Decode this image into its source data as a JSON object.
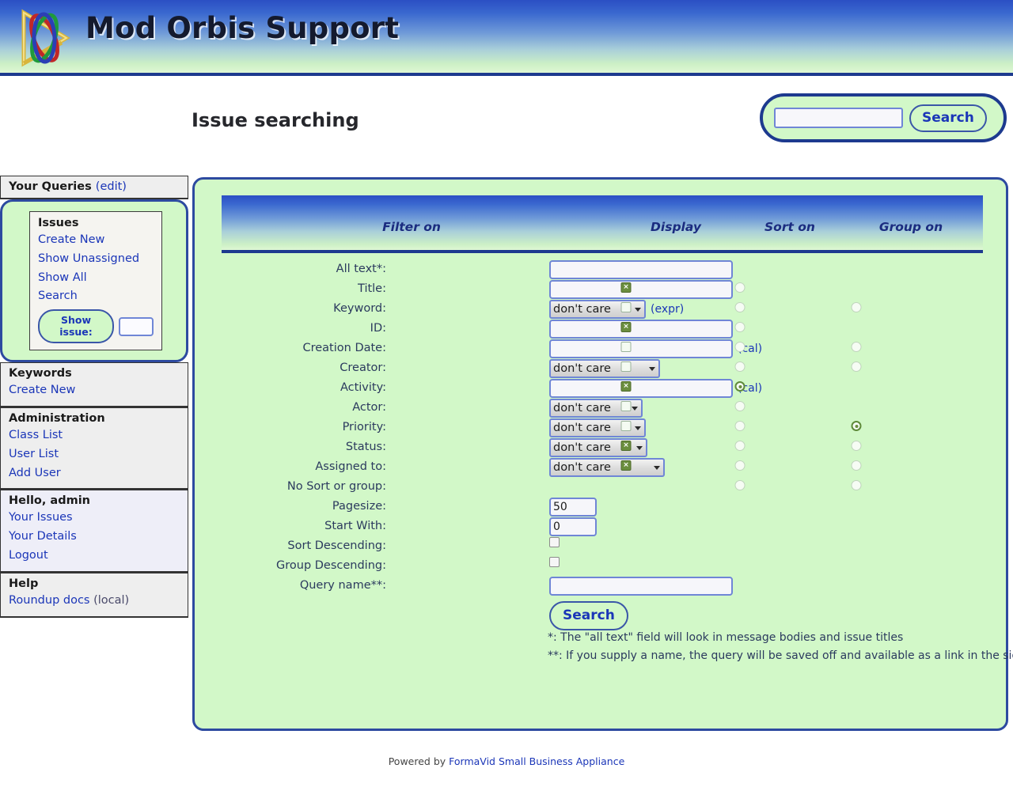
{
  "masthead": {
    "title": "Mod Orbis Support",
    "logo_icon": "orbis-rings-logo-icon"
  },
  "page": {
    "title": "Issue searching"
  },
  "global_search": {
    "value": "",
    "placeholder": "",
    "button_label": "Search",
    "icon": "search-icon"
  },
  "sidebar": {
    "queries": {
      "title": "Your Queries",
      "edit_label": "(edit)",
      "group_title": "Issues",
      "links": [
        "Create New",
        "Show Unassigned",
        "Show All",
        "Search"
      ],
      "show_issue_label": "Show issue:",
      "show_issue_value": ""
    },
    "sections": [
      {
        "title": "Keywords",
        "links": [
          "Create New"
        ],
        "variant": "plain"
      },
      {
        "title": "Administration",
        "links": [
          "Class List",
          "User List",
          "Add User"
        ],
        "variant": "plain"
      },
      {
        "title": "Hello, admin",
        "links": [
          "Your Issues",
          "Your Details",
          "Logout"
        ],
        "variant": "user"
      },
      {
        "title": "Help",
        "links": [
          "Roundup docs"
        ],
        "link_suffix": " (local)",
        "variant": "plain"
      }
    ]
  },
  "search_form": {
    "columns": [
      "Filter on",
      "Display",
      "Sort on",
      "Group on"
    ],
    "rows": [
      {
        "label": "All text*:",
        "control": "text",
        "value": "",
        "width": "wide",
        "hint": "",
        "display": null,
        "sort": null,
        "group": null
      },
      {
        "label": "Title:",
        "control": "text",
        "value": "",
        "width": "wide",
        "hint": "",
        "display": true,
        "sort": false,
        "group": null
      },
      {
        "label": "Keyword:",
        "control": "select",
        "value": "don't care",
        "select_width": 122,
        "hint": "(expr)",
        "display": false,
        "sort": false,
        "group": false
      },
      {
        "label": "ID:",
        "control": "text",
        "value": "",
        "width": "wide",
        "hint": "",
        "display": true,
        "sort": false,
        "group": null
      },
      {
        "label": "Creation Date:",
        "control": "text",
        "value": "",
        "width": "wide",
        "hint": "(cal)",
        "display": false,
        "sort": false,
        "group": false
      },
      {
        "label": "Creator:",
        "control": "select",
        "value": "don't care",
        "select_width": 140,
        "hint": "",
        "display": false,
        "sort": false,
        "group": false
      },
      {
        "label": "Activity:",
        "control": "text",
        "value": "",
        "width": "wide",
        "hint": "(cal)",
        "display": true,
        "sort": true,
        "group": null
      },
      {
        "label": "Actor:",
        "control": "select",
        "value": "don't care",
        "select_width": 118,
        "hint": "",
        "display": false,
        "sort": false,
        "group": null
      },
      {
        "label": "Priority:",
        "control": "select",
        "value": "don't care",
        "select_width": 122,
        "hint": "",
        "display": false,
        "sort": false,
        "group": true
      },
      {
        "label": "Status:",
        "control": "select",
        "value": "don't care",
        "select_width": 124,
        "hint": "",
        "display": true,
        "sort": false,
        "group": false
      },
      {
        "label": "Assigned to:",
        "control": "select",
        "value": "don't care",
        "select_width": 146,
        "hint": "",
        "display": true,
        "sort": false,
        "group": false
      },
      {
        "label": "No Sort or group:",
        "control": "none",
        "value": "",
        "hint": "",
        "display": null,
        "sort": false,
        "group": false
      },
      {
        "label": "Pagesize:",
        "control": "text",
        "value": "50",
        "width": "num",
        "hint": "",
        "display": null,
        "sort": null,
        "group": null
      },
      {
        "label": "Start With:",
        "control": "text",
        "value": "0",
        "width": "num",
        "hint": "",
        "display": null,
        "sort": null,
        "group": null
      },
      {
        "label": "Sort Descending:",
        "control": "checkbox",
        "checked": false,
        "hint": "",
        "display": null,
        "sort": null,
        "group": null
      },
      {
        "label": "Group Descending:",
        "control": "checkbox",
        "checked": false,
        "hint": "",
        "display": null,
        "sort": null,
        "group": null
      },
      {
        "label": "Query name**:",
        "control": "text",
        "value": "",
        "width": "wide",
        "hint": "",
        "display": null,
        "sort": null,
        "group": null
      }
    ],
    "submit_label": "Search",
    "notes": [
      "*: The \"all text\" field will look in message bodies and issue titles",
      "**: If you supply a name, the query will be saved off and available as a link in the sidebar"
    ]
  },
  "footer": {
    "prefix": "Powered by ",
    "link": "FormaVid Small Business Appliance"
  },
  "colors": {
    "panel_green": "#d2f8c8",
    "border_navy": "#2d4aa0",
    "link_blue": "#1b36b8",
    "header_blue": "#2b4fc4",
    "checked_green": "#6b8e3e"
  }
}
